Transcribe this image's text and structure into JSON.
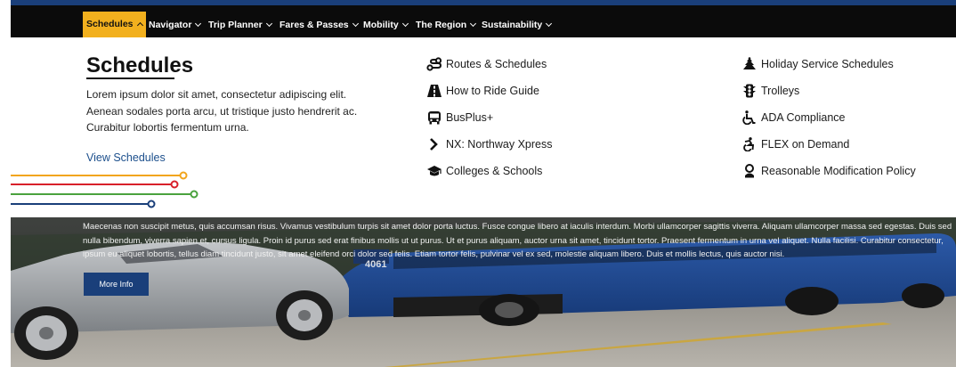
{
  "nav": {
    "items": [
      {
        "label": "Schedules",
        "active": true
      },
      {
        "label": "Navigator",
        "active": false
      },
      {
        "label": "Trip Planner",
        "active": false
      },
      {
        "label": "Fares & Passes",
        "active": false
      },
      {
        "label": "Mobility",
        "active": false
      },
      {
        "label": "The Region",
        "active": false
      },
      {
        "label": "Sustainability",
        "active": false
      }
    ]
  },
  "mega": {
    "title": "Schedules",
    "description": "Lorem ipsum dolor sit amet, consectetur adipiscing elit. Aenean sodales porta arcu, ut tristique justo hendrerit ac. Curabitur lobortis fermentum urna.",
    "view_link": "View Schedules",
    "column_middle": [
      {
        "label": "Routes & Schedules",
        "icon": "route-icon"
      },
      {
        "label": "How to Ride Guide",
        "icon": "road-icon"
      },
      {
        "label": "BusPlus+",
        "icon": "bus-icon"
      },
      {
        "label": "NX: Northway Xpress",
        "icon": "chevron-right-icon"
      },
      {
        "label": "Colleges & Schools",
        "icon": "graduation-cap-icon"
      }
    ],
    "column_right": [
      {
        "label": "Holiday Service Schedules",
        "icon": "holiday-tree-icon"
      },
      {
        "label": "Trolleys",
        "icon": "traffic-light-icon"
      },
      {
        "label": "ADA Compliance",
        "icon": "wheelchair-icon"
      },
      {
        "label": "FLEX on Demand",
        "icon": "accessible-icon"
      },
      {
        "label": "Reasonable Modification Policy",
        "icon": "person-icon"
      }
    ],
    "route_line_colors": [
      "#f2a51c",
      "#d8202a",
      "#4aa23e",
      "#1a3f7a"
    ]
  },
  "hero": {
    "text": "Maecenas non suscipit metus, quis accumsan risus. Vivamus vestibulum turpis sit amet dolor porta luctus. Fusce congue libero at iaculis interdum. Morbi ullamcorper sagittis viverra. Aliquam ullamcorper massa sed egestas. Duis sed nulla bibendum, viverra sapien et, cursus ligula. Proin id purus sed erat finibus mollis ut ut purus. Ut et purus aliquam, auctor urna sit amet, tincidunt tortor. Praesent fermentum in urna vel aliquet. Nulla facilisi. Curabitur consectetur, ipsum eu aliquet lobortis, tellus diam tincidunt justo, sit amet eleifend orci dolor sed felis. Etiam tortor felis, pulvinar vel ex sed, molestie aliquam libero. Duis et mollis lectus, quis auctor nisi.",
    "button": "More Info",
    "bus_number": "4061"
  },
  "colors": {
    "navbar": "#0b0b0b",
    "active_tab": "#f2b01e",
    "brand_blue": "#1a3f7a",
    "link_blue": "#1c4f8c"
  }
}
